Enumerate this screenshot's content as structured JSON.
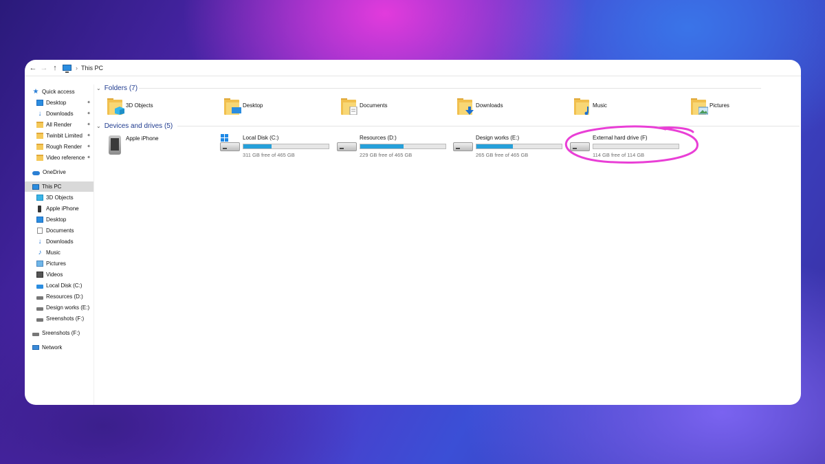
{
  "address": {
    "back": "←",
    "forward": "→",
    "up": "↑",
    "path": "This PC"
  },
  "sidebar": {
    "items": [
      {
        "label": "Quick access",
        "icon": "quick-access-star-icon",
        "pinned": false
      },
      {
        "label": "Desktop",
        "icon": "desktop-icon",
        "pinned": true
      },
      {
        "label": "Downloads",
        "icon": "downloads-icon",
        "pinned": true
      },
      {
        "label": "All Render",
        "icon": "folder-icon",
        "pinned": true
      },
      {
        "label": "Twinbit Limited",
        "icon": "folder-icon",
        "pinned": true
      },
      {
        "label": "Rough Render",
        "icon": "folder-icon",
        "pinned": true
      },
      {
        "label": "Video reference",
        "icon": "folder-icon",
        "pinned": true
      },
      {
        "label": "OneDrive",
        "icon": "onedrive-cloud-icon"
      },
      {
        "label": "This PC",
        "icon": "this-pc-icon",
        "selected": true
      },
      {
        "label": "3D Objects",
        "icon": "3d-objects-icon"
      },
      {
        "label": "Apple iPhone",
        "icon": "phone-icon"
      },
      {
        "label": "Desktop",
        "icon": "desktop-icon"
      },
      {
        "label": "Documents",
        "icon": "documents-icon"
      },
      {
        "label": "Downloads",
        "icon": "downloads-icon"
      },
      {
        "label": "Music",
        "icon": "music-icon"
      },
      {
        "label": "Pictures",
        "icon": "pictures-icon"
      },
      {
        "label": "Videos",
        "icon": "videos-icon"
      },
      {
        "label": "Local Disk (C:)",
        "icon": "windows-drive-icon"
      },
      {
        "label": "Resources (D:)",
        "icon": "drive-icon"
      },
      {
        "label": "Design works (E:)",
        "icon": "drive-icon"
      },
      {
        "label": "Sreenshots  (F:)",
        "icon": "drive-icon"
      },
      {
        "label": "Sreenshots  (F:)",
        "icon": "drive-icon"
      },
      {
        "label": "Network",
        "icon": "network-icon"
      }
    ],
    "pin_glyph": "📌"
  },
  "folders": {
    "header": "Folders (7)",
    "items": [
      {
        "label": "3D Objects",
        "icon": "3d-objects-folder-icon"
      },
      {
        "label": "Desktop",
        "icon": "desktop-folder-icon"
      },
      {
        "label": "Documents",
        "icon": "documents-folder-icon"
      },
      {
        "label": "Downloads",
        "icon": "downloads-folder-icon"
      },
      {
        "label": "Music",
        "icon": "music-folder-icon"
      },
      {
        "label": "Pictures",
        "icon": "pictures-folder-icon"
      }
    ]
  },
  "devices": {
    "header": "Devices and drives (5)",
    "phone": {
      "label": "Apple iPhone",
      "icon": "phone-icon"
    },
    "drives": [
      {
        "name": "Local Disk (C:)",
        "free": "311 GB free of 465 GB",
        "used_fraction": 0.33,
        "windows": true
      },
      {
        "name": "Resources (D:)",
        "free": "229 GB free of 465 GB",
        "used_fraction": 0.51
      },
      {
        "name": "Design works (E:)",
        "free": "265 GB free of 465 GB",
        "used_fraction": 0.43
      },
      {
        "name": "External hard drive (F)",
        "free": "114 GB free of 114 GB",
        "used_fraction": 0.0
      }
    ]
  },
  "colors": {
    "accent_fill": "#26a0da",
    "highlight": "#e93fd6",
    "group_header": "#1f3b8f"
  }
}
